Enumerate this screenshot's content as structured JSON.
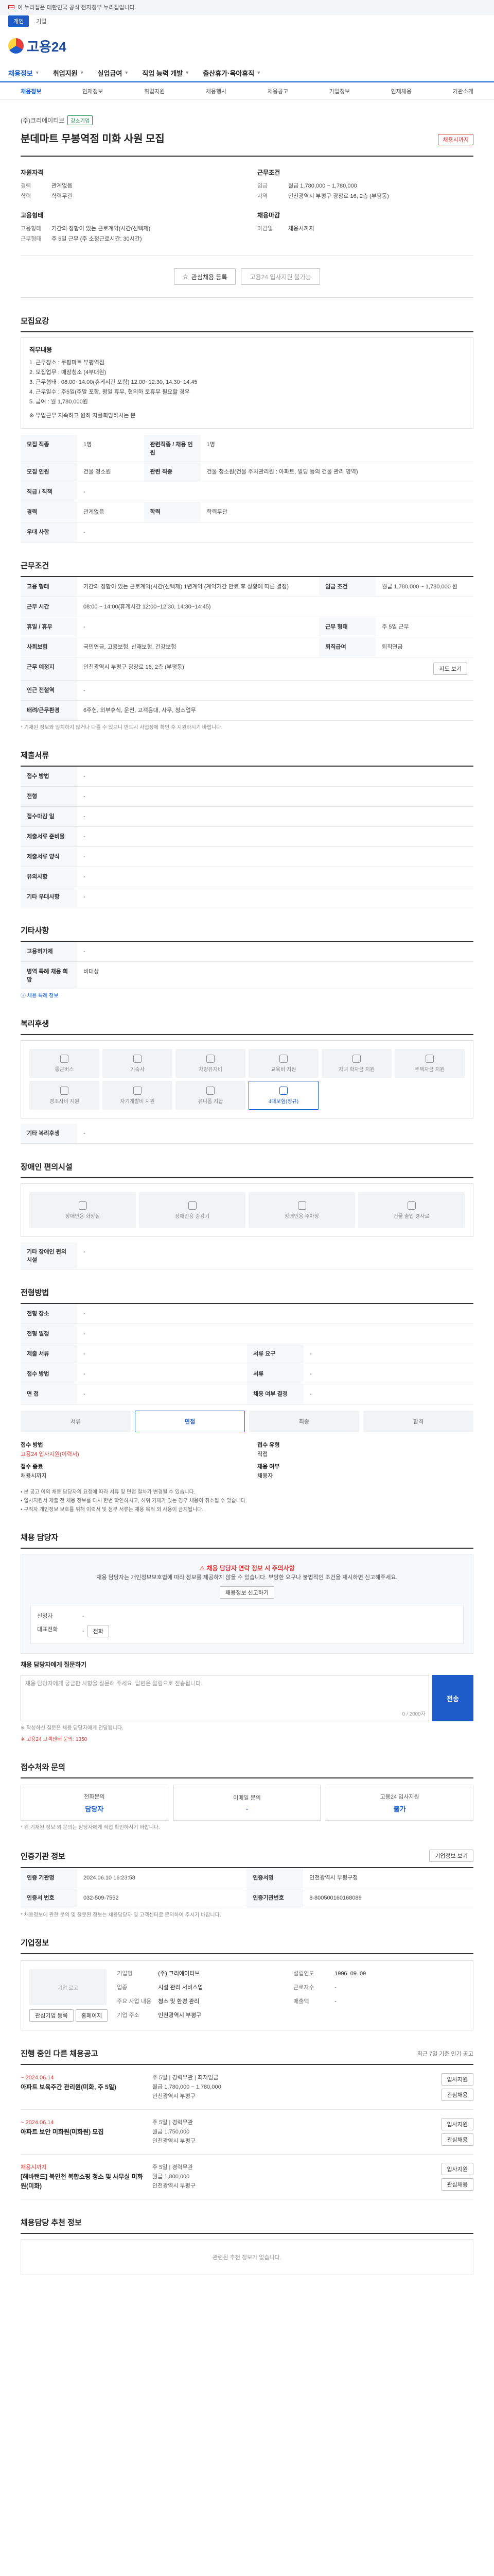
{
  "gov_banner": "이 누리집은 대한민국 공식 전자정부 누리집입니다.",
  "top_links": [
    "개인",
    "기업"
  ],
  "logo_text": "고용24",
  "main_nav": [
    "채용정보",
    "취업지원",
    "실업급여",
    "직업 능력 개발",
    "출산휴가·육아휴직"
  ],
  "sub_nav": [
    "채용정보",
    "인재정보",
    "취업지원",
    "채용행사",
    "채용공고",
    "기업정보",
    "인재채용",
    "기관소개"
  ],
  "job": {
    "company": "(주)크리에이티브",
    "company_badge": "강소기업",
    "title": "분데마트 무봉역점 미화 사원 모집",
    "deadline_badge": "채용시까지",
    "left_heading": "자원자격",
    "left_rows": [
      {
        "k": "경력",
        "v": "관계없음"
      },
      {
        "k": "학력",
        "v": "학력무관"
      }
    ],
    "left2_heading": "고용형태",
    "left2_rows": [
      {
        "k": "고용형태",
        "v": "기간의 정함이 있는 근로계약(시간(선택제)"
      },
      {
        "k": "근무형태",
        "v": "주 5일 근무 (주 소정근로시간: 30시간)"
      }
    ],
    "right_heading": "근무조건",
    "right_rows": [
      {
        "k": "임금",
        "v": "월급 1,780,000 ~ 1,780,000"
      },
      {
        "k": "지역",
        "v": "인천광역시 부평구 광장로 16, 2층 (부평동)"
      }
    ],
    "right2_heading": "채용마감",
    "right2_rows": [
      {
        "k": "마감일",
        "v": "채용시까지"
      }
    ],
    "btn_interest": "관심채용 등록",
    "btn_apply": "고용24 입사지원 불가능"
  },
  "sections": {
    "recruit": "모집요강",
    "conditions": "근무조건",
    "docs": "제출서류",
    "other": "기타사항",
    "welfare": "복리후생",
    "disability": "장애인 편의시설",
    "process": "전형방법",
    "inquiry": "채용 담당자",
    "contact": "접수처와 문의",
    "agency": "인증기관 정보",
    "company": "기업정보",
    "similar": "진행 중인 다른 채용공고",
    "recommend": "채용담당 추천 정보"
  },
  "duty": {
    "title": "직무내용",
    "lines": [
      "1. 근무장소 : 쿠팡마트 부평역점",
      "2. 모집업무 : 매장청소 (4부대원)",
      "3. 근무형태 : 08:00~14:00(휴게시간 포함) 12:00~12:30, 14:30~14:45",
      "4. 근무일수 : 주5일(주말 포함, 평일 휴무, 협의하 토휴무 필요할 경우",
      "5. 급여 : 월 1,780,000원"
    ],
    "tail": "※ 무업근무 지속하고 원하 자를희망하시는 분"
  },
  "recruit_rows": [
    {
      "k1": "모집 직종",
      "v1": "1명",
      "k2": "관련직종 / 채용 인원",
      "v2": "1명"
    },
    {
      "k1": "모집 인원",
      "v1": "건물 청소원",
      "k2": "관련 직종",
      "v2": "건물 청소원(건물 주차관리원 : 아파트, 빌딩 등의 건물 관리 영역)"
    },
    {
      "k1": "직급 / 직책",
      "v1": "-",
      "k2": "",
      "v2": ""
    },
    {
      "k1": "경력",
      "v1": "관계없음",
      "k2": "학력",
      "v2": "학력무관"
    },
    {
      "k1": "우대 사항",
      "v1": "-",
      "k2": "",
      "v2": ""
    }
  ],
  "cond_rows": [
    {
      "k": "고용 형태",
      "v": "기간의 정함이 있는 근로계약(시간(선택제) 1년계약 (계약기간 만료 후 상황에 따른 결정)",
      "k2": "임금 조건",
      "v2": "월급 1,780,000 ~ 1,780,000 원"
    },
    {
      "k": "근무 시간",
      "v": "08:00 ~ 14:00(휴게시간 12:00~12:30, 14:30~14:45)",
      "k2": "",
      "v2": ""
    },
    {
      "k": "휴일 / 휴무",
      "v": "-",
      "k2": "근무 형태",
      "v2": "주 5일 근무"
    },
    {
      "k": "사회보험",
      "v": "국민연금, 고용보험, 산재보험, 건강보험",
      "k2": "퇴직급여",
      "v2": "퇴직연금"
    },
    {
      "k": "근무 예정지",
      "v": "인천광역시 부평구 광장로 16, 2층 (부평동)",
      "k2": "",
      "v2": ""
    },
    {
      "k": "인근 전철역",
      "v": "-",
      "k2": "",
      "v2": ""
    },
    {
      "k": "배려/근무환경",
      "v": "6주헌, 외부휴식, 운전, 고객응대, 사무, 청소업무",
      "k2": "",
      "v2": ""
    }
  ],
  "cond_map_btn": "지도 보기",
  "cond_note": "* 기재된 정보와 일치하지 않거나 다를 수 있으니 반드시 사업장에 확인 후 지원하시기 바랍니다.",
  "docs_rows": [
    {
      "k": "접수 방법",
      "v": "-"
    },
    {
      "k": "전형",
      "v": "-"
    },
    {
      "k": "접수마감 일",
      "v": "-"
    },
    {
      "k": "제출서류 준비물",
      "v": "-"
    },
    {
      "k": "제출서류 양식",
      "v": "-"
    },
    {
      "k": "유의사항",
      "v": "-"
    },
    {
      "k": "기타 우대사항",
      "v": "-"
    }
  ],
  "other_rows": [
    {
      "k": "고용허가제",
      "v": "-"
    },
    {
      "k": "병역 특례 채용 희망",
      "v": "비대상"
    }
  ],
  "other_link": "채용 특례 정보",
  "welfare_items": [
    {
      "label": "통근버스",
      "on": false
    },
    {
      "label": "기숙사",
      "on": false
    },
    {
      "label": "차량유지비",
      "on": false
    },
    {
      "label": "교육비 지원",
      "on": false
    },
    {
      "label": "자녀 학자금 지원",
      "on": false
    },
    {
      "label": "주택자금 지원",
      "on": false
    },
    {
      "label": "경조사비 지원",
      "on": false
    },
    {
      "label": "자기계발비 지원",
      "on": false
    },
    {
      "label": "유니폼 지급",
      "on": false
    },
    {
      "label": "4대보험(정규)",
      "on": true
    }
  ],
  "welfare_other": "기타 복리후생",
  "dis_items": [
    "장애인용 화장실",
    "장애인용 승강기",
    "장애인용 주차장",
    "건물 출입 경사로"
  ],
  "dis_other": "기타 장애인 편의시설",
  "process_rows": [
    {
      "k": "전형 장소",
      "v": "-"
    },
    {
      "k": "전형 일정",
      "v": "-"
    },
    {
      "k": "제출 서류",
      "v": "-",
      "k2": "서류 요구",
      "v2": "-"
    },
    {
      "k": "접수 방법",
      "v": "-",
      "k2": "서류",
      "v2": "-"
    },
    {
      "k": "면 접",
      "v": "-",
      "k2": "채용 여부 결정",
      "v2": "-"
    }
  ],
  "steps": [
    "서류",
    "면접",
    "최종",
    "합격"
  ],
  "selection": {
    "k1": "접수 방법",
    "v1": "고용24 입사지원(이력서)",
    "k2": "접수 종료",
    "v2": "채용시까지",
    "k3": "접수 유형",
    "v3": "직접",
    "k4": "채용 여부",
    "v4": "채용자"
  },
  "process_bullets": [
    "• 본 공고 이외 채용 담당자의 요청에 따라 서류 및 면접 절차가 변경될 수 있습니다.",
    "• 입사지원서 제출 전 채용 정보를 다시 한번 확인하시고, 허위 기재가 있는 경우 채용이 취소될 수 있습니다.",
    "• 구직자 개인정보 보호를 위해 이력서 및 첨부 서류는 채용 목적 외 사용이 금지됩니다."
  ],
  "inquiry": {
    "warn": "채용 담당자 연락 정보 시 주의사항",
    "desc": "채용 담당자는 개인정보보호법에 따라 정보를 제공하지 않을 수 있습니다. 부당한 요구나 불법적인 조건을 제시하면 신고해주세요.",
    "btn": "채용정보 신고하기",
    "name_label": "신청자",
    "name_value": "-",
    "phone_label": "대표전화",
    "phone_value": "-",
    "phone_btn": "전화",
    "q_label": "채용 담당자에게 질문하기",
    "q_placeholder": "채용 담당자에게 궁금한 사항을 질문해 주세요. 답변은 알림으로 전송됩니다.",
    "q_count": "0 / 2000자",
    "q_btn": "전송",
    "notes": [
      "※ 작성하신 질문은 채용 담당자에게 전달됩니다.",
      "※ 고용24 고객센터 문의: 1350"
    ]
  },
  "contact": [
    {
      "label": "전화문의",
      "value": "담당자"
    },
    {
      "label": "이메일 문의",
      "value": "-"
    },
    {
      "label": "고용24 입사지원",
      "value": "불가"
    }
  ],
  "contact_note": "* 위 기재된 정보 외 문의는 담당자에게 직접 확인하시기 바랍니다.",
  "agency_rows": [
    {
      "k": "인증 기관명",
      "v": "2024.06.10 16:23:58",
      "k2": "인증서명",
      "v2": "인천광역시 부평구청"
    },
    {
      "k": "인증서 번호",
      "v": "032-509-7552",
      "k2": "인증기관번호",
      "v2": "8-800500160168089"
    }
  ],
  "agency_btn": "기업정보 보기",
  "agency_note": "* 채용정보에 관한 문의 및 잘못된 정보는 채용담당자 및 고객센터로 문의하여 주시기 바랍니다.",
  "company": {
    "logo_alt": "기업 로고",
    "btn_interest": "관심기업 등록",
    "btn_home": "홈페이지",
    "rows": [
      {
        "k": "기업명",
        "v": "(주) 크리에이티브",
        "k2": "설립연도",
        "v2": "1996. 09. 09"
      },
      {
        "k": "업종",
        "v": "시설 관리 서비스업",
        "k2": "근로자수",
        "v2": "-"
      },
      {
        "k": "주요 사업 내용",
        "v": "청소 및 환경 관리",
        "k2": "매출액",
        "v2": "-"
      },
      {
        "k": "기업 주소",
        "v": "인천광역시 부평구",
        "k2": "",
        "v2": ""
      }
    ]
  },
  "similar_header_note": "최근 7일 기준 인기 공고",
  "similar_jobs": [
    {
      "date": "~ 2024.06.14",
      "title": "아파트 보육주간 관리원(미화, 주 5일)",
      "meta": "주 5일 | 경력무관 | 최저임금",
      "cond": "월급 1,780,000 ~ 1,780,000",
      "loc": "인천광역시 부평구",
      "btn1": "입사지원",
      "btn2": "관심채용"
    },
    {
      "date": "~ 2024.06.14",
      "title": "아파트 보안 미화원(미화원) 모집",
      "meta": "주 5일 | 경력무관",
      "cond": "월급 1,750,000",
      "loc": "인천광역시 부평구",
      "btn1": "입사지원",
      "btn2": "관심채용"
    },
    {
      "date": "채용시까지",
      "title": "[해바랜드] 북인천 복합쇼핑 청소 및 사무실 미화원(미화)",
      "meta": "주 5일 | 경력무관",
      "cond": "월급 1,800,000",
      "loc": "인천광역시 부평구",
      "btn1": "입사지원",
      "btn2": "관심채용"
    }
  ],
  "recommend_empty": "관련된 추천 정보가 없습니다."
}
